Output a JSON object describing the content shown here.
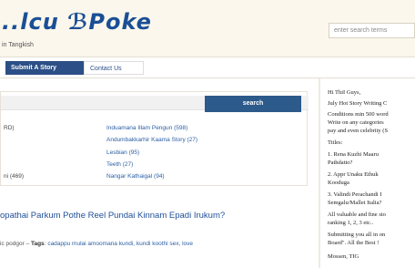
{
  "header": {
    "logo": "..lcu ℬPoke",
    "tagline": "in Tangkish",
    "search_placeholder": "enter search terms"
  },
  "nav": {
    "items": [
      {
        "label": "Submit A Story"
      },
      {
        "label": "Contact Us"
      }
    ]
  },
  "panel": {
    "button_label": "search",
    "rows": [
      {
        "left": "RD)",
        "right": "Induamana Illam Pengun (598)"
      },
      {
        "left": "",
        "right": "Andumbakkarhir Kaama Story (27)"
      },
      {
        "left": "",
        "right": "Lesbian (95)"
      },
      {
        "left": "",
        "right": "Teeth (27)"
      },
      {
        "left": "ni (469)",
        "right": "Nangar Kathaigal (94)"
      }
    ]
  },
  "post": {
    "title": "opathai Parkum Pothe Reel Pundai Kinnam Epadi Irukum?",
    "author": "ic podgor",
    "tags_label": "Tags",
    "tags": "cadappu mulai amoomana kundi, kundi koothi sex, love"
  },
  "sidebar": {
    "lines": [
      "Hi ThiI Guys,",
      "July Hot Story Writing C",
      "Conditions min 500 word",
      " Write on any categories",
      "pay and even celebrity (S",
      "Titles:",
      "1.    Rena Kuzhi Maaru",
      "Pathdatto?",
      "2.    Appr Unaku Ethuk",
      "Kooduga",
      "3.    Valindi Perachandi I",
      "Semgalu/Mallet Italia?",
      " All valuable and fine sto",
      "ranking 1, 2, 3 etc..",
      "Submitting you all in on",
      "Board\". All the Best !",
      "Mossen, TIG"
    ]
  }
}
